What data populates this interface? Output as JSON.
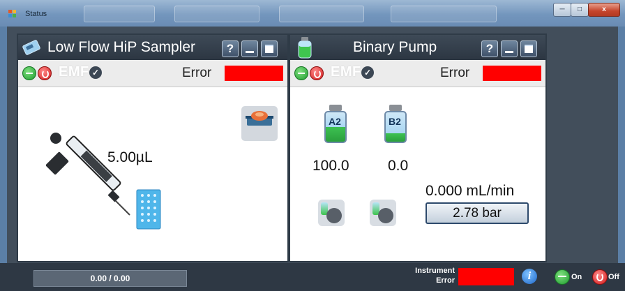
{
  "window": {
    "title": "Status",
    "controls": [
      "minimize",
      "maximize",
      "close"
    ],
    "close_glyph": "x"
  },
  "sampler": {
    "title": "Low Flow HiP Sampler",
    "help_label": "?",
    "emf_label": "EMF",
    "error_label": "Error",
    "volume": "5.00µL",
    "icons": [
      "sampler-module-icon",
      "syringe-icon",
      "well-plate-icon",
      "tray-icon"
    ]
  },
  "pump": {
    "title": "Binary Pump",
    "help_label": "?",
    "emf_label": "EMF",
    "error_label": "Error",
    "solvents": [
      {
        "label": "A2",
        "value": "100.0"
      },
      {
        "label": "B2",
        "value": "0.0"
      }
    ],
    "flow": "0.000 mL/min",
    "pressure": "2.78 bar",
    "icons": [
      "pump-module-icon",
      "solvent-valve-icon"
    ]
  },
  "footer": {
    "progress": "0.00 / 0.00",
    "instrument_error_label": "Instrument\nError",
    "info_glyph": "i",
    "on_label": "On",
    "off_label": "Off"
  },
  "colors": {
    "error_red": "#ff0000",
    "on_green": "#1f9b2f",
    "off_red": "#d11a1a",
    "header_dark": "#2c3642",
    "info_blue": "#1d66c9"
  }
}
